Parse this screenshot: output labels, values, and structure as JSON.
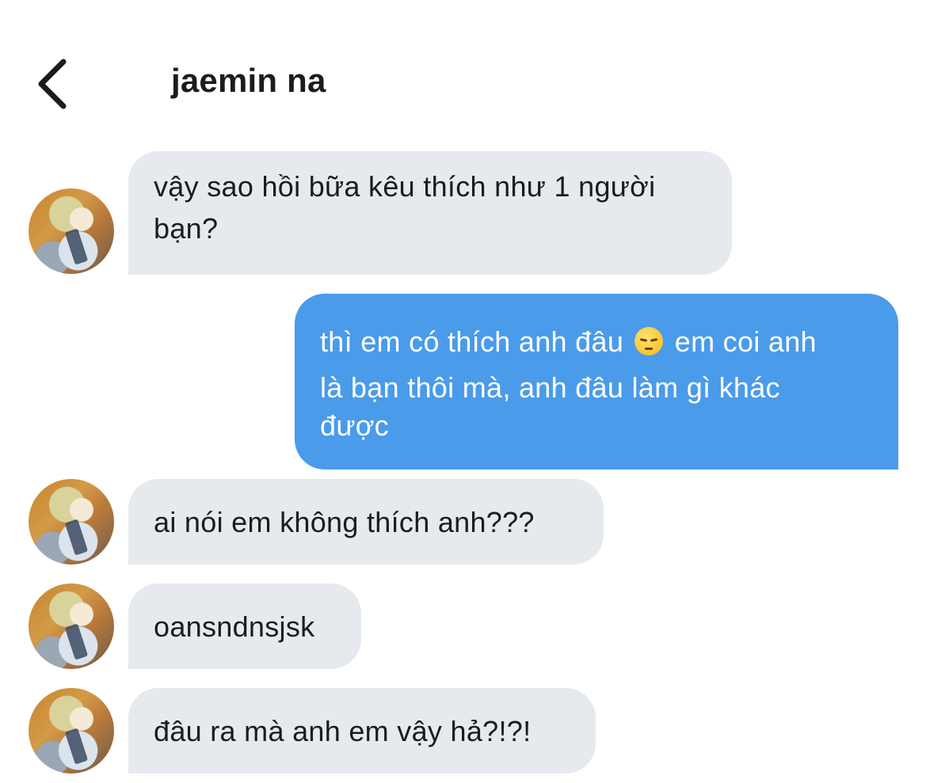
{
  "header": {
    "back_icon": "chevron-left-icon",
    "contact_name": "jaemin na"
  },
  "messages": [
    {
      "side": "received",
      "lines": [
        "vậy sao hồi bữa kêu thích như 1 người",
        "bạn?"
      ]
    },
    {
      "side": "sent",
      "line1_before_emoji": "thì em có thích anh đâu",
      "emoji": "pensive-face-icon",
      "line1_after_emoji": "em coi anh",
      "line2": "là bạn thôi mà, anh đâu làm gì khác",
      "line3": "được"
    },
    {
      "side": "received",
      "text": "ai nói em không thích anh???"
    },
    {
      "side": "received",
      "text": "oansndnsjsk"
    },
    {
      "side": "received",
      "text": "đâu ra mà anh em vậy hả?!?!"
    }
  ],
  "colors": {
    "received_bubble": "#e6e9ed",
    "sent_bubble": "#4a9be9",
    "background": "#ffffff",
    "text": "#1c1c1e"
  }
}
